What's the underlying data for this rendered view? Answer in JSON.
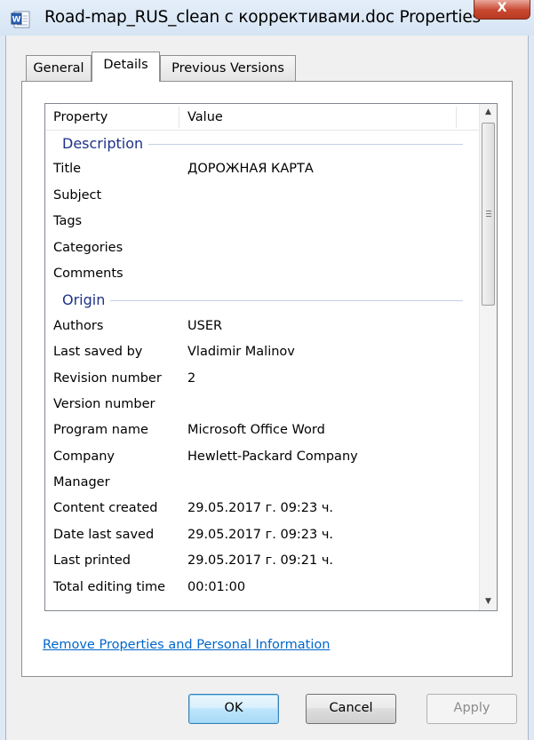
{
  "window": {
    "title": "Road-map_RUS_clean с коррективами.doc Properties",
    "close_label": "X"
  },
  "tabs": [
    {
      "label": "General",
      "active": false
    },
    {
      "label": "Details",
      "active": true
    },
    {
      "label": "Previous Versions",
      "active": false
    }
  ],
  "columns": {
    "property": "Property",
    "value": "Value"
  },
  "groups": {
    "description": {
      "label": "Description",
      "rows": [
        {
          "name": "Title",
          "value": "ДОРОЖНАЯ КАРТА"
        },
        {
          "name": "Subject",
          "value": ""
        },
        {
          "name": "Tags",
          "value": ""
        },
        {
          "name": "Categories",
          "value": ""
        },
        {
          "name": "Comments",
          "value": ""
        }
      ]
    },
    "origin": {
      "label": "Origin",
      "rows": [
        {
          "name": "Authors",
          "value": "USER"
        },
        {
          "name": "Last saved by",
          "value": "Vladimir Malinov"
        },
        {
          "name": "Revision number",
          "value": "2"
        },
        {
          "name": "Version number",
          "value": ""
        },
        {
          "name": "Program name",
          "value": "Microsoft Office Word"
        },
        {
          "name": "Company",
          "value": "Hewlett-Packard Company"
        },
        {
          "name": "Manager",
          "value": ""
        },
        {
          "name": "Content created",
          "value": "29.05.2017 г. 09:23 ч."
        },
        {
          "name": "Date last saved",
          "value": "29.05.2017 г. 09:23 ч."
        },
        {
          "name": "Last printed",
          "value": "29.05.2017 г. 09:21 ч."
        },
        {
          "name": "Total editing time",
          "value": "00:01:00"
        }
      ]
    }
  },
  "link": {
    "label": "Remove Properties and Personal Information"
  },
  "buttons": {
    "ok": "OK",
    "cancel": "Cancel",
    "apply": "Apply"
  },
  "colors": {
    "group_header": "#1e3287",
    "link": "#0066cc",
    "close_button": "#c8472f"
  },
  "icons": {
    "window": "word-document-icon",
    "scroll_up": "arrow-up-icon",
    "scroll_down": "arrow-down-icon"
  }
}
